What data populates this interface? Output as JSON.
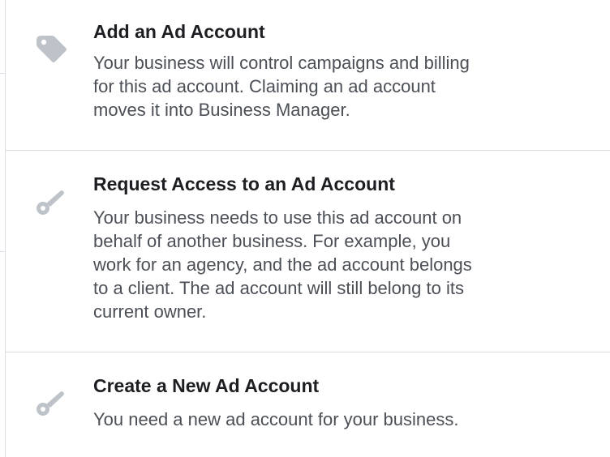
{
  "options": [
    {
      "icon": "tag-icon",
      "title": "Add an Ad Account",
      "description_lines": [
        "Your business will control campaigns and billing",
        "for this ad account. Claiming an ad account",
        "moves it into Business Manager."
      ]
    },
    {
      "icon": "key-icon",
      "title": "Request Access to an Ad Account",
      "description_lines": [
        "Your business needs to use this ad account on",
        "behalf of another business. For example, you",
        "work for an agency, and the ad account belongs",
        "to a client. The ad account will still belong to its",
        "current owner."
      ]
    },
    {
      "icon": "key-icon",
      "title": "Create a New Ad Account",
      "description_lines": [
        "You need a new ad account for your business."
      ]
    }
  ],
  "colors": {
    "icon": "#bec3c9",
    "title": "#1c1e21",
    "description": "#4b4f56",
    "divider": "#dadde1"
  }
}
